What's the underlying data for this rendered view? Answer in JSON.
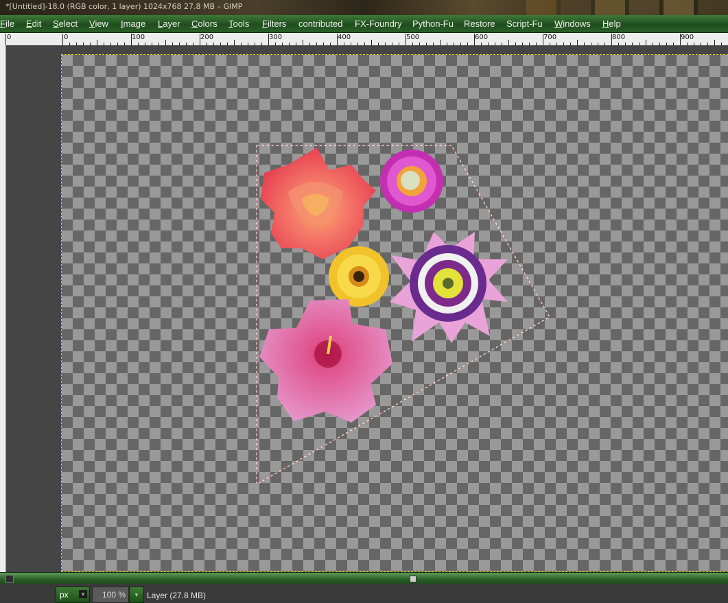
{
  "window": {
    "title": "*[Untitled]-18.0 (RGB color, 1 layer) 1024x768 27.8 MB – GIMP"
  },
  "menubar": {
    "items": [
      {
        "label": "File"
      },
      {
        "label": "Edit"
      },
      {
        "label": "Select"
      },
      {
        "label": "View"
      },
      {
        "label": "Image"
      },
      {
        "label": "Layer"
      },
      {
        "label": "Colors"
      },
      {
        "label": "Tools"
      },
      {
        "label": "Filters"
      },
      {
        "label": "contributed"
      },
      {
        "label": "FX-Foundry"
      },
      {
        "label": "Python-Fu"
      },
      {
        "label": "Restore"
      },
      {
        "label": "Script-Fu"
      },
      {
        "label": "Windows"
      },
      {
        "label": "Help"
      }
    ]
  },
  "ruler": {
    "labels": [
      "0",
      "0",
      "100",
      "200",
      "300",
      "400",
      "500",
      "600",
      "700",
      "800",
      "900"
    ]
  },
  "canvas": {
    "selection": "free-select polygon",
    "layer_content": [
      "rose",
      "strawflower",
      "gerbera-daisy",
      "passion-flower",
      "hibiscus"
    ]
  },
  "statusbar": {
    "unit": "px",
    "zoom": "100 %",
    "layer_info": "Layer (27.8 MB)"
  },
  "colors": {
    "menubar_green": "#2c5f28",
    "checker_dark": "#666666",
    "checker_light": "#999999",
    "canvas_border": "#e6d400",
    "selection_outline": "#ffffff"
  }
}
